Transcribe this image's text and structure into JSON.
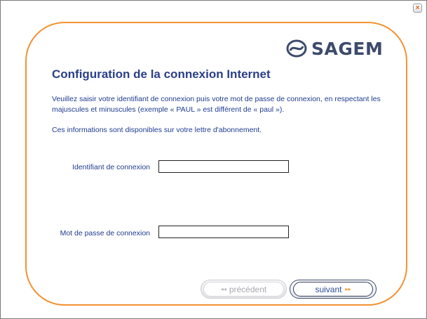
{
  "window": {
    "close_glyph": "×"
  },
  "brand": {
    "name": "SAGEM",
    "color": "#3d4a6b",
    "frame_color": "#f39233"
  },
  "page": {
    "title": "Configuration de la connexion Internet",
    "intro": "Veuillez saisir votre identifiant de connexion puis votre mot de passe de connexion, en respectant les majuscules et minuscules (exemple « PAUL » est différent de « paul »).",
    "info": "Ces informations sont disponibles sur votre lettre d'abonnement."
  },
  "form": {
    "login_label": "Identifiant de connexion",
    "login_value": "",
    "password_label": "Mot de passe de connexion",
    "password_value": ""
  },
  "buttons": {
    "previous_label": "précédent",
    "previous_icon": "double-left-arrow-icon",
    "previous_enabled": false,
    "next_label": "suivant",
    "next_icon": "double-right-arrow-icon",
    "next_enabled": true
  }
}
